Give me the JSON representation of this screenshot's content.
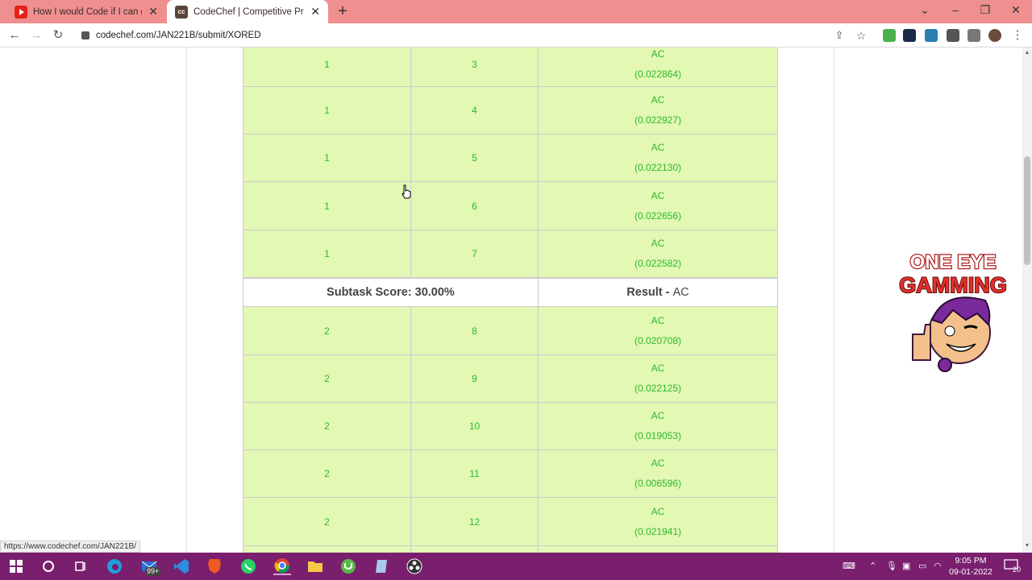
{
  "browser": {
    "tabs": [
      {
        "title": "How I would Code if I can get ba",
        "icon": "youtube-icon"
      },
      {
        "title": "CodeChef | Competitive Program",
        "icon": "codechef-icon"
      }
    ],
    "url": "codechef.com/JAN221B/submit/XORED",
    "status_link": "https://www.codechef.com/JAN221B/"
  },
  "table": {
    "rows_a": [
      {
        "subtask": "1",
        "task": "3",
        "result": "AC",
        "time": "(0.022864)"
      },
      {
        "subtask": "1",
        "task": "4",
        "result": "AC",
        "time": "(0.022927)"
      },
      {
        "subtask": "1",
        "task": "5",
        "result": "AC",
        "time": "(0.022130)"
      },
      {
        "subtask": "1",
        "task": "6",
        "result": "AC",
        "time": "(0.022656)"
      },
      {
        "subtask": "1",
        "task": "7",
        "result": "AC",
        "time": "(0.022582)"
      }
    ],
    "subtask_summary": {
      "score_label": "Subtask Score: 30.00%",
      "result_prefix": "Result -",
      "result_value": "AC"
    },
    "rows_b": [
      {
        "subtask": "2",
        "task": "8",
        "result": "AC",
        "time": "(0.020708)"
      },
      {
        "subtask": "2",
        "task": "9",
        "result": "AC",
        "time": "(0.022125)"
      },
      {
        "subtask": "2",
        "task": "10",
        "result": "AC",
        "time": "(0.019053)"
      },
      {
        "subtask": "2",
        "task": "11",
        "result": "AC",
        "time": "(0.006596)"
      },
      {
        "subtask": "2",
        "task": "12",
        "result": "AC",
        "time": "(0.021941)"
      }
    ]
  },
  "overlay_logo": {
    "line1": "ONE EYE",
    "line2": "GAMMING"
  },
  "taskbar": {
    "mail_badge": "99+",
    "time": "9:05 PM",
    "date": "09-01-2022",
    "notifications": "20"
  },
  "colors": {
    "tab_strip": "#ef8f8f",
    "row_ac_bg": "#e2f8b3",
    "ac_text": "#2fb82f",
    "taskbar": "#7a1f6e"
  }
}
